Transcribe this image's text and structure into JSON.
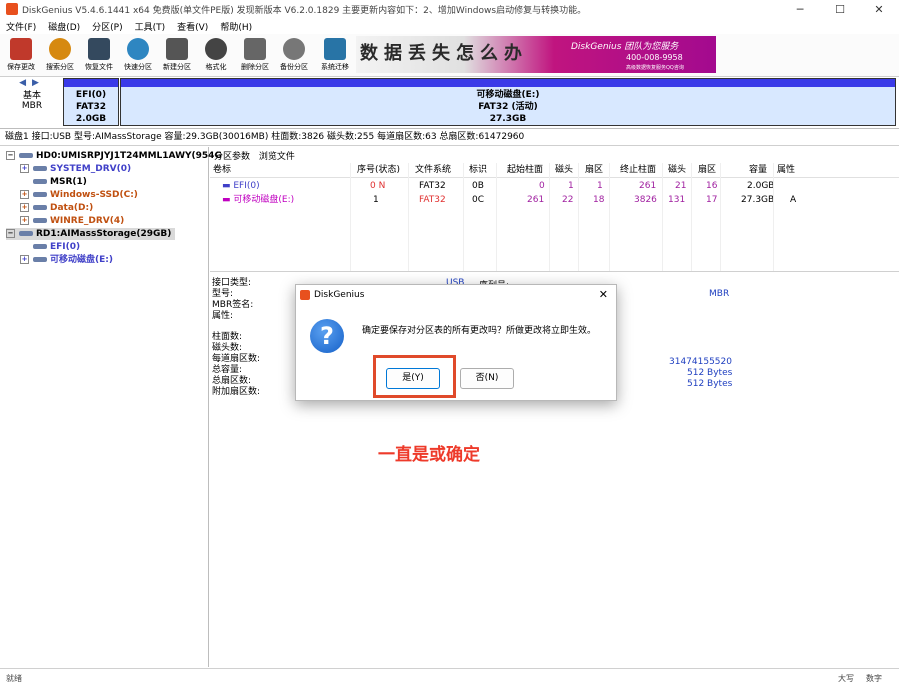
{
  "window": {
    "title": "DiskGenius V5.4.6.1441 x64 免费版(单文件PE版)   发现新版本 V6.2.0.1829   主要更新内容如下：2、增加Windows启动修复与转换功能。"
  },
  "menu": [
    "文件(F)",
    "磁盘(D)",
    "分区(P)",
    "工具(T)",
    "查看(V)",
    "帮助(H)"
  ],
  "toolbar": [
    {
      "label": "保存更改",
      "icon": "save-icon",
      "color": "#c0392b"
    },
    {
      "label": "搜索分区",
      "icon": "search-icon",
      "color": "#d68910"
    },
    {
      "label": "恢复文件",
      "icon": "recover-icon",
      "color": "#34495e"
    },
    {
      "label": "快速分区",
      "icon": "disk-icon",
      "color": "#2e86c1"
    },
    {
      "label": "新建分区",
      "icon": "stack-icon",
      "color": "#555555"
    },
    {
      "label": "格式化",
      "icon": "format-icon",
      "color": "#444444"
    },
    {
      "label": "删除分区",
      "icon": "trash-icon",
      "color": "#666666"
    },
    {
      "label": "备份分区",
      "icon": "backup-icon",
      "color": "#777777"
    },
    {
      "label": "系统迁移",
      "icon": "migrate-icon",
      "color": "#2874a6"
    }
  ],
  "banner": {
    "chars": "数据丢失怎么办",
    "brand": "DiskGenius 团队为您服务",
    "phone": "400-008-9958",
    "sub": "高级数据恢复服务QQ咨询"
  },
  "diskbar": {
    "nav_line1": "基本",
    "nav_line2": "MBR",
    "partitions": [
      {
        "name": "EFI(0)",
        "fs": "FAT32",
        "size": "2.0GB"
      },
      {
        "name": "可移动磁盘(E:)",
        "fs": "FAT32 (活动)",
        "size": "27.3GB"
      }
    ]
  },
  "disk_info": "磁盘1 接口:USB  型号:AIMassStorage  容量:29.3GB(30016MB)  柱面数:3826  磁头数:255  每道扇区数:63  总扇区数:61472960",
  "tree": {
    "hd0": "HD0:UMISRPJYJ1T24MML1AWY(954G",
    "hd0_parts": [
      "SYSTEM_DRV(0)",
      "MSR(1)",
      "Windows-SSD(C:)",
      "Data(D:)",
      "WINRE_DRV(4)"
    ],
    "rd1": "RD1:AIMassStorage(29GB)",
    "rd1_parts": [
      "EFI(0)",
      "可移动磁盘(E:)"
    ]
  },
  "tabs": [
    "分区参数",
    "浏览文件"
  ],
  "table": {
    "headers": [
      "卷标",
      "序号(状态)",
      "文件系统",
      "标识",
      "起始柱面",
      "磁头",
      "扇区",
      "终止柱面",
      "磁头",
      "扇区",
      "容量",
      "属性"
    ],
    "rows": [
      [
        "EFI(0)",
        "0 N",
        "FAT32",
        "0B",
        "0",
        "1",
        "1",
        "261",
        "21",
        "16",
        "2.0GB",
        ""
      ],
      [
        "可移动磁盘(E:)",
        "1",
        "FAT32",
        "0C",
        "261",
        "22",
        "18",
        "3826",
        "131",
        "17",
        "27.3GB",
        "A"
      ]
    ]
  },
  "details": {
    "labels1": [
      "接口类型:",
      "型号:",
      "MBR签名:",
      "属性:"
    ],
    "iface_value": "USB",
    "serial_label": "序列号:",
    "mbr_value": "MBR",
    "labels2": [
      "柱面数:",
      "磁头数:",
      "每道扇区数:",
      "总容量:",
      "总扇区数:",
      "附加扇区数:"
    ],
    "total_sectors": "31474155520",
    "sector_size1": "512 Bytes",
    "sector_size2": "512 Bytes"
  },
  "dialog": {
    "title": "DiskGenius",
    "message": "确定要保存对分区表的所有更改吗？所做更改将立即生效。",
    "yes": "是(Y)",
    "no": "否(N)"
  },
  "annotation": "一直是或确定",
  "status": {
    "left": "就绪",
    "right1": "大写",
    "right2": "数字"
  }
}
